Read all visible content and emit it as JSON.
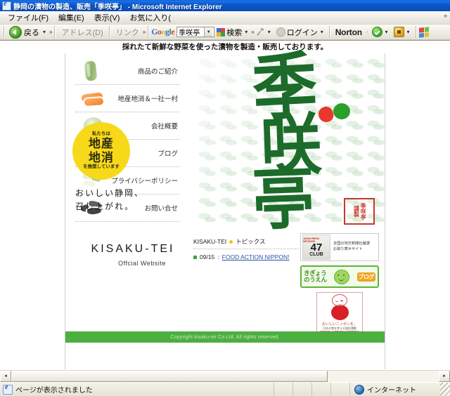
{
  "window": {
    "title": "静岡の漬物の製造、販売「季咲亭」 - Microsoft Internet Explorer",
    "icon": "ie-icon"
  },
  "menubar": {
    "items": [
      {
        "label": "ファイル(F)"
      },
      {
        "label": "編集(E)"
      },
      {
        "label": "表示(V)"
      },
      {
        "label": "お気に入り("
      }
    ],
    "overflow": "»"
  },
  "toolbar": {
    "back_label": "戻る",
    "back_dropdown": "▾",
    "overflow1": "»",
    "address_label": "アドレス(D)",
    "links_label": "リンク",
    "overflow2": "»",
    "google": {
      "logo_letters": [
        "G",
        "o",
        "o",
        "g",
        "l",
        "e"
      ],
      "search_value": "季咲亭",
      "dropdown_glyph": "▼",
      "search_label": "検索",
      "search_dropdown": "▾",
      "overflow": "»",
      "wrench_dropdown": "▾",
      "login_label": "ログイン",
      "login_dropdown": "▾"
    },
    "norton": {
      "label": "Norton",
      "label_dropdown": "·",
      "check_dropdown": "▾",
      "lock_dropdown": "▾"
    }
  },
  "page": {
    "header_tagline": "採れたて新鮮な野菜を使った漬物を製造・販売しております。",
    "menu": [
      {
        "label": "商品のご紹介",
        "icon": "cucumber-icon"
      },
      {
        "label": "地産地消＆一社一村",
        "icon": "carrot-icon"
      },
      {
        "label": "会社概要",
        "icon": "cabbage-icon"
      },
      {
        "label": "ブログ",
        "icon": "green-beans-icon"
      },
      {
        "label": "プライバシーポリシー",
        "icon": "leek-icon"
      },
      {
        "label": "お問い合せ",
        "icon": "dark-greens-icon"
      }
    ],
    "logo": {
      "kanji_1": "季",
      "kanji_2": "咲",
      "kanji_3": "亭"
    },
    "chisan_badge": {
      "top": "私たちは",
      "line1": "地産",
      "line2": "地消",
      "bottom": "を推奨しています"
    },
    "tagline_line1": "おいしい静岡、",
    "tagline_line2": "召し上がれ。",
    "seal": {
      "right": "季咲亭",
      "left": "謹製"
    },
    "brand": {
      "name": "KISAKU-TEI",
      "subtitle": "Offcial Website"
    },
    "topics": {
      "heading_prefix": "KISAKU-TEI",
      "heading_label": "トピックス",
      "items": [
        {
          "date": "09/15",
          "separator": ":",
          "link": "FOOD ACTION NIPPON!"
        }
      ]
    },
    "banners": {
      "club47": {
        "tiny": "JAPAN PRESS NETWORK",
        "number": "47",
        "word": "CLUB",
        "text_line1": "全国の地方新聞社厳選",
        "text_line2": "お取り寄せサイト"
      },
      "blog": {
        "line1": "きぎょう",
        "line2": "のうえん",
        "burst": "ブログ"
      },
      "fan": {
        "jp": "おいしいニッポンを。",
        "sub": "日本の食を考える国民運動",
        "en": "FOOD ACTION NIPPON"
      }
    },
    "footer_copyright": "Copyright kisaku-tei Co.Ltd. All rights reserved."
  },
  "scrollbars": {
    "left_arrow": "◄",
    "right_arrow": "►",
    "up_arrow": "▲"
  },
  "statusbar": {
    "message": "ページが表示されました",
    "zone": "インターネット"
  }
}
